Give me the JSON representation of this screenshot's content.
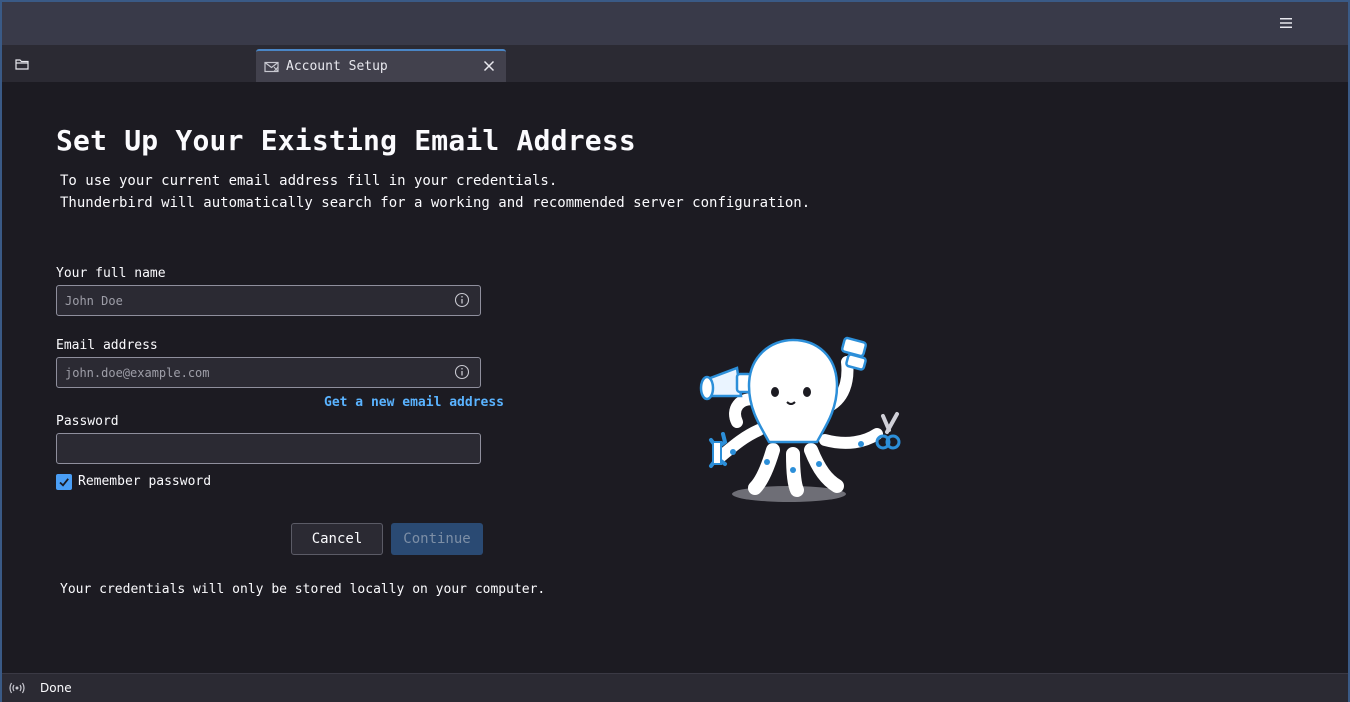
{
  "tabs": [
    {
      "label": "Account Setup",
      "icon": "envelope-icon"
    }
  ],
  "page": {
    "title": "Set Up Your Existing Email Address",
    "intro_line1": "To use your current email address fill in your credentials.",
    "intro_line2": "Thunderbird will automatically search for a working and recommended server configuration."
  },
  "form": {
    "name_label": "Your full name",
    "name_placeholder": "John Doe",
    "name_value": "",
    "email_label": "Email address",
    "email_placeholder": "john.doe@example.com",
    "email_value": "",
    "new_email_link": "Get a new email address",
    "password_label": "Password",
    "password_value": "",
    "remember_label": "Remember password",
    "remember_checked": true,
    "cancel_label": "Cancel",
    "continue_label": "Continue",
    "footnote": "Your credentials will only be stored locally on your computer."
  },
  "status": {
    "text": "Done",
    "icon": "broadcast-icon"
  },
  "colors": {
    "accent": "#5ab3ff",
    "checkbox": "#4a9ef5",
    "continue_bg": "#2a4a73",
    "background": "#1c1b22",
    "titlebar": "#393a49"
  }
}
